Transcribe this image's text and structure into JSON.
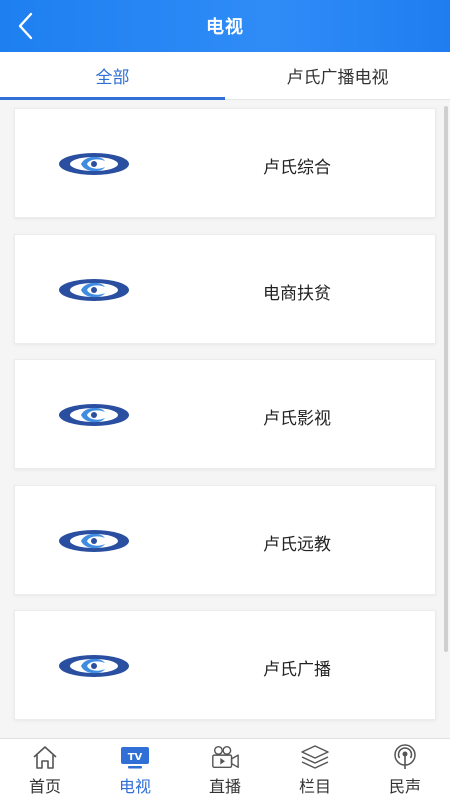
{
  "header": {
    "title": "电视",
    "back_icon": "chevron-left-icon"
  },
  "tabs": [
    {
      "label": "全部",
      "active": true
    },
    {
      "label": "卢氏广播电视",
      "active": false
    }
  ],
  "channels": [
    {
      "label": "卢氏综合",
      "icon": "channel-logo-icon"
    },
    {
      "label": "电商扶贫",
      "icon": "channel-logo-icon"
    },
    {
      "label": "卢氏影视",
      "icon": "channel-logo-icon"
    },
    {
      "label": "卢氏远教",
      "icon": "channel-logo-icon"
    },
    {
      "label": "卢氏广播",
      "icon": "channel-logo-icon"
    }
  ],
  "bottom_nav": [
    {
      "label": "首页",
      "icon": "home-icon",
      "active": false
    },
    {
      "label": "电视",
      "icon": "tv-icon",
      "active": true
    },
    {
      "label": "直播",
      "icon": "video-camera-icon",
      "active": false
    },
    {
      "label": "栏目",
      "icon": "layers-icon",
      "active": false
    },
    {
      "label": "民声",
      "icon": "broadcast-icon",
      "active": false
    }
  ],
  "colors": {
    "accent": "#2f6fd6",
    "header": "#2a88f5"
  }
}
